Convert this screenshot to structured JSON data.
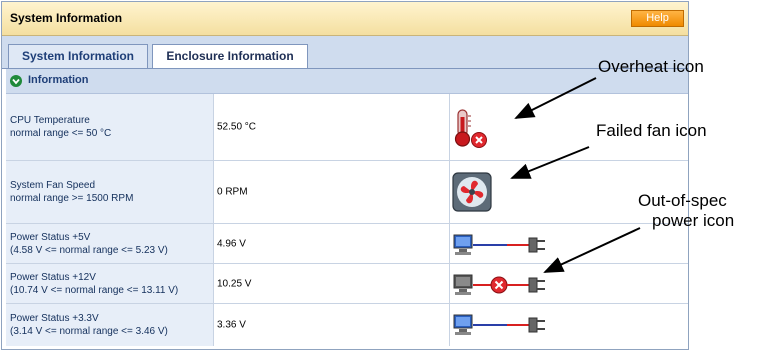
{
  "window": {
    "title": "System Information",
    "help_label": "Help"
  },
  "tabs": [
    {
      "label": "System Information",
      "active": false
    },
    {
      "label": "Enclosure Information",
      "active": true
    }
  ],
  "section": {
    "label": "Information"
  },
  "rows": [
    {
      "label": "CPU Temperature",
      "range": "normal range <= 50 °C",
      "value": "52.50 °C",
      "status_icon": "overheat-thermometer-icon"
    },
    {
      "label": "System Fan Speed",
      "range": "normal range >= 1500 RPM",
      "value": "0 RPM",
      "status_icon": "failed-fan-icon"
    },
    {
      "label": "Power Status +5V",
      "range": "(4.58 V <= normal range <= 5.23 V)",
      "value": "4.96 V",
      "status_icon": "power-ok-icon"
    },
    {
      "label": "Power Status +12V",
      "range": "(10.74 V <= normal range <= 13.11 V)",
      "value": "10.25 V",
      "status_icon": "power-out-of-spec-icon"
    },
    {
      "label": "Power Status +3.3V",
      "range": "(3.14 V <= normal range <= 3.46 V)",
      "value": "3.36 V",
      "status_icon": "power-ok-icon"
    }
  ],
  "callouts": {
    "overheat": "Overheat icon",
    "failed_fan": "Failed fan icon",
    "out_of_spec_line1": "Out-of-spec",
    "out_of_spec_line2": "power icon"
  },
  "colors": {
    "title_bar": "#f4dfa0",
    "help_button": "#ef8a00",
    "tab_bar": "#cfdcee",
    "label_cell": "#e7eef8",
    "error_red": "#e0282e"
  }
}
